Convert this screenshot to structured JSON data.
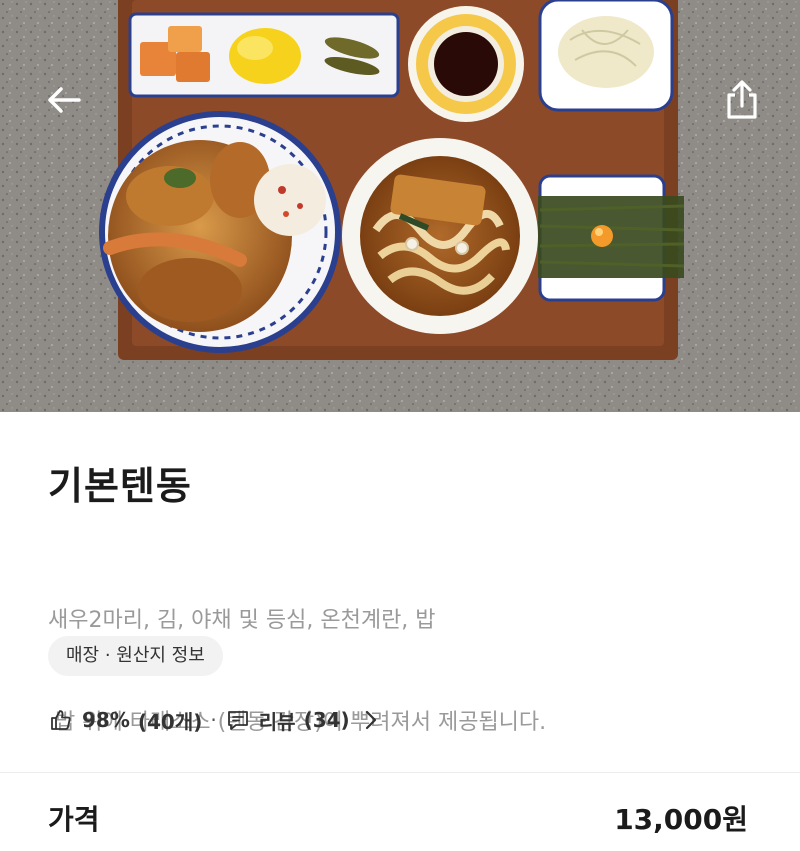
{
  "menu": {
    "title": "기본텐동",
    "description_lines": [
      "새우2마리, 김, 야채 및 등심, 온천계란, 밥",
      " 밥 위에 타래소스 (텐동 간장)이 뿌려져서 제공됩니다."
    ],
    "origin_chip": "매장 · 원산지 정보"
  },
  "stats": {
    "like_rate": "98%",
    "like_count": "(40개)",
    "separator": "·",
    "review_label": "리뷰",
    "review_count": "(34)"
  },
  "price": {
    "label": "가격",
    "value": "13,000원"
  },
  "icons": {
    "back": "arrow-left-icon",
    "share": "share-icon",
    "like": "thumbs-up-icon",
    "review": "speech-bubble-icon",
    "review_chevron": "chevron-right-icon"
  },
  "colors": {
    "title": "#1b1b1b",
    "description": "#9a9a9a",
    "chip_bg": "#f2f2f2"
  }
}
